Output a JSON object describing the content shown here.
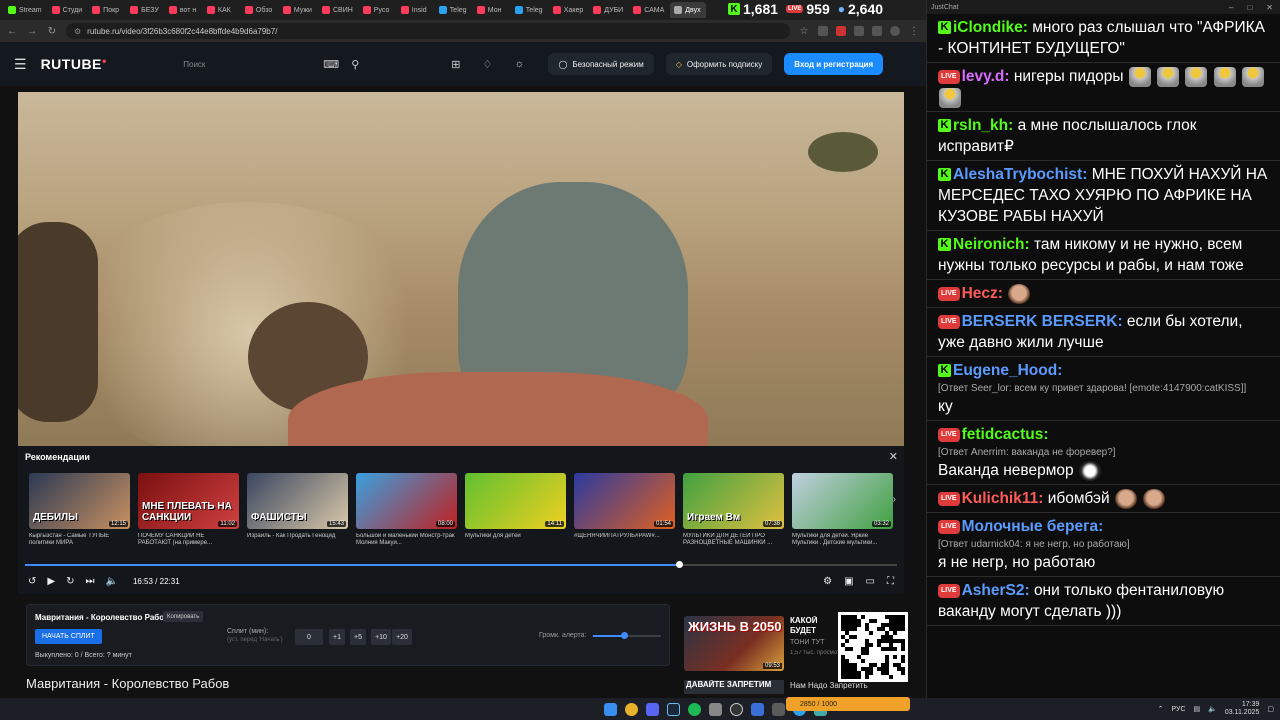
{
  "browser": {
    "tabs": [
      {
        "label": "Stream",
        "color": "#53fc18"
      },
      {
        "label": "Студи",
        "color": "#ff3b5c"
      },
      {
        "label": "Покр",
        "color": "#ff3b5c"
      },
      {
        "label": "БЕЗУ",
        "color": "#ff3b5c"
      },
      {
        "label": "вот н",
        "color": "#ff3b5c"
      },
      {
        "label": "КАК",
        "color": "#ff3b5c"
      },
      {
        "label": "Обзо",
        "color": "#ff3b5c"
      },
      {
        "label": "Мужи",
        "color": "#ff3b5c"
      },
      {
        "label": "СВИН",
        "color": "#ff3b5c"
      },
      {
        "label": "Русо",
        "color": "#ff3b5c"
      },
      {
        "label": "Insid",
        "color": "#ff3b5c"
      },
      {
        "label": "Teleg",
        "color": "#2aa3ef"
      },
      {
        "label": "Мон",
        "color": "#ff3b5c"
      },
      {
        "label": "Teleg",
        "color": "#2aa3ef"
      },
      {
        "label": "Хакер",
        "color": "#ff3b5c"
      },
      {
        "label": "ДУБИ",
        "color": "#ff3b5c"
      },
      {
        "label": "САМА",
        "color": "#ff3b5c"
      },
      {
        "label": "Двух",
        "color": "#aaaaaa"
      }
    ],
    "url": "rutube.ru/video/3f26b3c680f2c44e8bffde4b9d6a79b7/"
  },
  "stream_counters": {
    "kick": "1,681",
    "live": "959",
    "viewers": "2,640"
  },
  "header": {
    "logo": "RUTUBE",
    "search_placeholder": "Поиск",
    "safe_mode": "Безопасный режим",
    "subscribe": "Оформить подписку",
    "login": "Вход и регистрация"
  },
  "player": {
    "recommendations_title": "Рекомендации",
    "current_time": "16:53 / 22:31",
    "progress": 0.75,
    "recommendations": [
      {
        "title": "Кыргызстан - Самые ТУПЫЕ политики МИРА",
        "duration": "12:15",
        "caption": "ДЕБИЛЫ",
        "c1": "#2c3a55",
        "c2": "#c89060"
      },
      {
        "title": "ПОЧЕМУ САНКЦИИ НЕ РАБОТАЮТ (на примере...",
        "duration": "11:02",
        "caption": "МНЕ ПЛЕВАТЬ НА САНКЦИИ",
        "c1": "#7a1010",
        "c2": "#d04040"
      },
      {
        "title": "Израиль - Как Продать Геноцид",
        "duration": "15:43",
        "caption": "ФАШИСТЫ",
        "c1": "#3a4660",
        "c2": "#d8c8a8"
      },
      {
        "title": "Большой и маленький Монстр-трак Молния Макуи...",
        "duration": "08:00",
        "caption": "",
        "c1": "#3aa0e0",
        "c2": "#c02020"
      },
      {
        "title": "Мультики для детей",
        "duration": "14:11",
        "caption": "",
        "c1": "#60c030",
        "c2": "#f0d020"
      },
      {
        "title": "#ЩЕНЯЧИЙПАТРУЛЬ#PAW#...",
        "duration": "01:54",
        "caption": "",
        "c1": "#2a3aa0",
        "c2": "#e06020"
      },
      {
        "title": "МУЛЬТИКИ ДЛЯ ДЕТЕЙ ПРО РАЗНОЦВЕТНЫЕ МАШИНКИ ...",
        "duration": "07:38",
        "caption": "Играем Вм",
        "c1": "#40a040",
        "c2": "#e0c040"
      },
      {
        "title": "Мультики для детей. Яркие Мультики . Детские мультики...",
        "duration": "03:32",
        "caption": "",
        "c1": "#c0d0e0",
        "c2": "#40a040"
      }
    ]
  },
  "split": {
    "title": "Мавритания - Королевство Рабов",
    "copy": "Копировать",
    "start": "НАЧАТЬ СПЛИТ",
    "stats": "Выкуплено: 0 / Всего: ? минут",
    "label": "Сплит (мин):",
    "hint": "(уст. перед 'Начать')",
    "value": "0",
    "buttons": [
      "+1",
      "+5",
      "+10",
      "+20"
    ],
    "alert_label": "Громк. алерта:",
    "alert_volume": 0.45
  },
  "video_title": "Мавритания - Королевство Рабов",
  "side": {
    "thumb_caption": "ЖИЗНЬ В 2050",
    "duration": "09:53",
    "title": "КАКОЙ БУДЕТ ЖИЗНЬ В 2050",
    "author": "ТОНИ ТУТ",
    "views": "1,57 тыс. просмотров",
    "thumb2_caption": "ДАВАЙТЕ ЗАПРЕТИМ",
    "title2": "Нам Надо Запретить"
  },
  "chat": {
    "app_name": "JustChat",
    "messages": [
      {
        "platform": "kick",
        "user": "iClondike",
        "color": "#53fc18",
        "text": "много раз слышал что \"АФРИКА - КОНТИНЕТ БУДУЩЕГО\""
      },
      {
        "platform": "live",
        "user": "levy.d",
        "color": "#d86bff",
        "text": "нигеры пидоры",
        "emotes": 6
      },
      {
        "platform": "kick",
        "user": "rsln_kh",
        "color": "#53fc18",
        "text": "а мне послышалось глок исправит₽"
      },
      {
        "platform": "kick",
        "user": "AleshaTrybochist",
        "color": "#5b9bff",
        "text": "МНЕ ПОХУЙ НАХУЙ НА МЕРСЕДЕС ТАХО ХУЯРЮ ПО АФРИКЕ НА КУЗОВЕ РАБЫ НАХУЙ"
      },
      {
        "platform": "kick",
        "user": "Neironich",
        "color": "#53fc18",
        "text": "там никому и не нужно, всем нужны только ресурсы и рабы, и нам тоже"
      },
      {
        "platform": "live",
        "user": "Hecz",
        "color": "#ff5a5a",
        "text": "",
        "emotes": 1
      },
      {
        "platform": "live",
        "user": "BERSERK BERSERK",
        "color": "#5b9bff",
        "text": "если бы хотели, уже давно жили лучше"
      },
      {
        "platform": "kick",
        "user": "Eugene_Hood",
        "color": "#5b9bff",
        "reply": "[Ответ Seer_lor: всем ку привет здарова! [emote:4147900:catKISS]]",
        "text": "ку"
      },
      {
        "platform": "live",
        "user": "fetidcactus",
        "color": "#53fc18",
        "reply": "[Ответ Anerrim: ваканда не форевер?]",
        "text": "Ваканда невермор",
        "emotes": 1
      },
      {
        "platform": "live",
        "user": "Kulichik11",
        "color": "#ff5a5a",
        "text": "ибомбэй",
        "emotes": 2
      },
      {
        "platform": "live",
        "user": "Молочные берега",
        "color": "#5b9bff",
        "reply": "[Ответ udarnick04: я не негр, но работаю]",
        "text": "я не негр, но работаю"
      },
      {
        "platform": "live",
        "user": "AsherS2",
        "color": "#5b9bff",
        "text": "они только фентаниловую ваканду могут сделать )))"
      }
    ]
  },
  "taskbar": {
    "lang": "РУС",
    "time": "17:39",
    "date": "03.11.2025",
    "overlay": "2850 / 1000"
  }
}
